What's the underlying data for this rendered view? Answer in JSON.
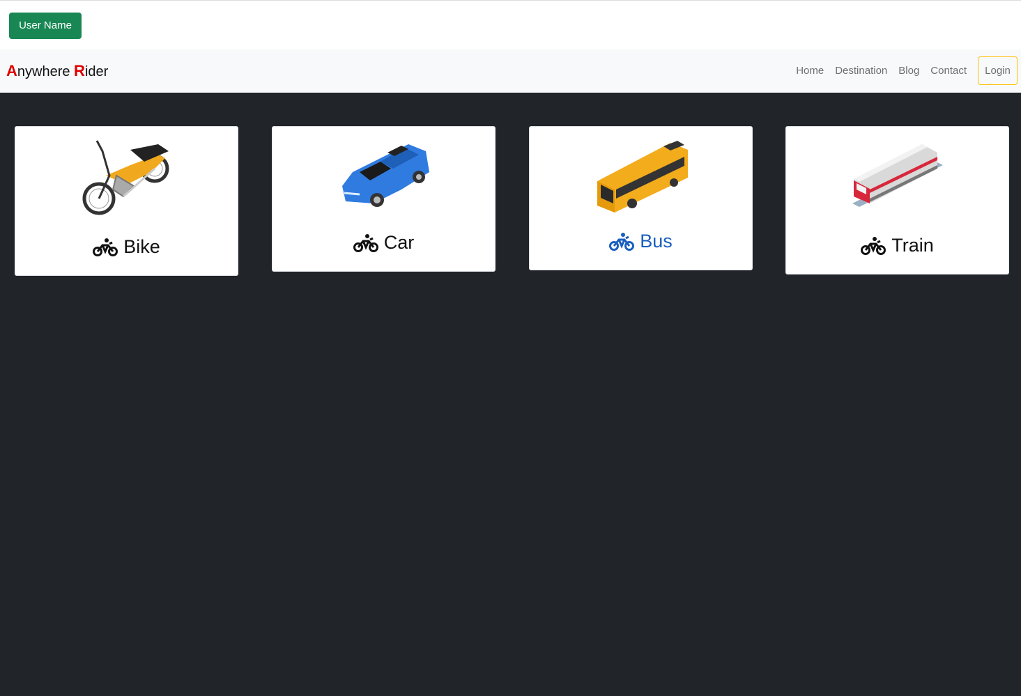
{
  "topbar": {
    "user_button_label": "User Name"
  },
  "navbar": {
    "brand": {
      "first_cap": "A",
      "first_rest": "nywhere ",
      "second_cap": "R",
      "second_rest": "ider"
    },
    "links": [
      "Home",
      "Destination",
      "Blog",
      "Contact"
    ],
    "login_label": "Login"
  },
  "cards": [
    {
      "label": "Bike",
      "icon": "motorcycle-icon",
      "image": "motorcycle-image"
    },
    {
      "label": "Car",
      "icon": "motorcycle-icon",
      "image": "car-image"
    },
    {
      "label": "Bus",
      "icon": "motorcycle-icon",
      "image": "bus-image"
    },
    {
      "label": "Train",
      "icon": "motorcycle-icon",
      "image": "train-image"
    }
  ],
  "colors": {
    "user_button": "#198754",
    "login_border": "#ffc107",
    "brand_accent": "#e00000",
    "active_card_text": "#1a5fbf",
    "page_background": "#212529"
  }
}
